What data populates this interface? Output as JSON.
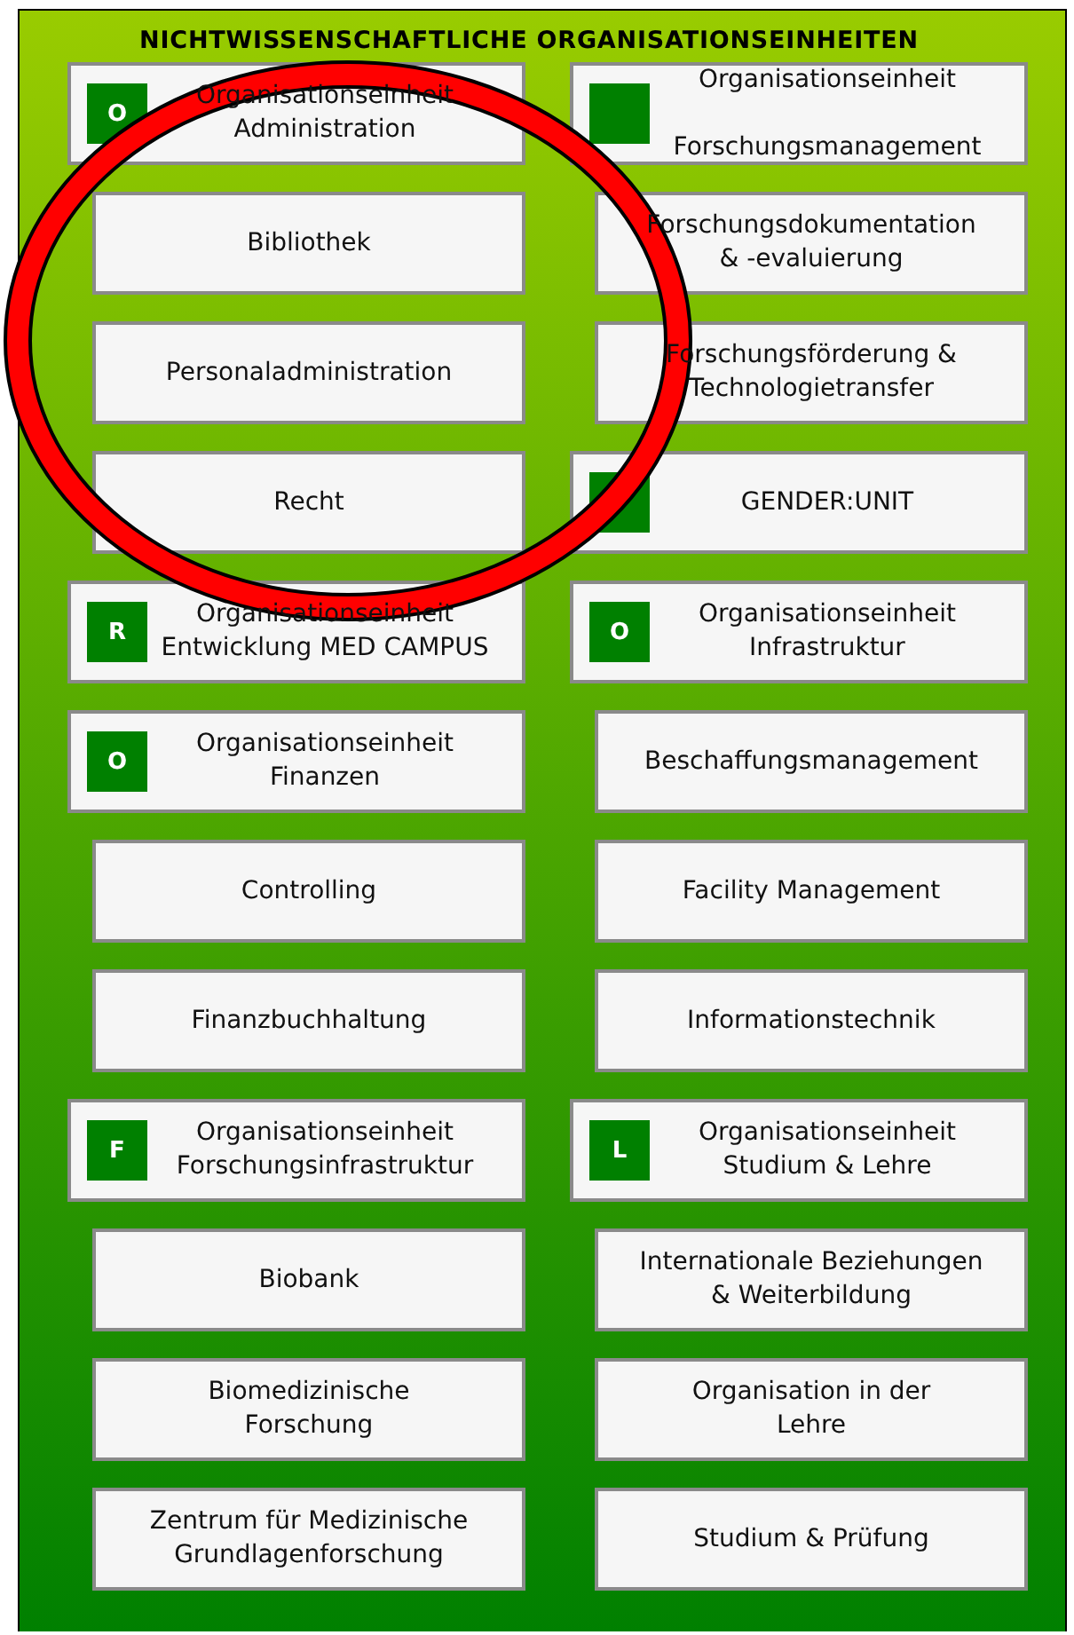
{
  "title": "NICHTWISSENSCHAFTLICHE ORGANISATIONSEINHEITEN",
  "rows": [
    {
      "left": {
        "kind": "unit",
        "badge": "O",
        "text": "Organisationseinheit\nAdministration"
      },
      "right": {
        "kind": "unit",
        "text": "Organisationseinheit\n\nForschungsmanagement"
      }
    },
    {
      "left": {
        "kind": "sub",
        "text": "Bibliothek"
      },
      "right": {
        "kind": "sub",
        "text": "Forschungsdokumentation\n& -evaluierung"
      }
    },
    {
      "left": {
        "kind": "sub",
        "text": "Personaladministration"
      },
      "right": {
        "kind": "sub",
        "text": "Forschungsförderung &\nTechnologietransfer"
      }
    },
    {
      "left": {
        "kind": "sub",
        "text": "Recht"
      },
      "right": {
        "kind": "unit",
        "text": "GENDER:UNIT"
      }
    },
    {
      "left": {
        "kind": "unit",
        "badge": "R",
        "text": "Organisationseinheit\nEntwicklung MED CAMPUS"
      },
      "right": {
        "kind": "unit",
        "badge": "O",
        "text": "Organisationseinheit\nInfrastruktur"
      }
    },
    {
      "left": {
        "kind": "unit",
        "badge": "O",
        "text": "Organisationseinheit\nFinanzen"
      },
      "right": {
        "kind": "sub",
        "text": "Beschaffungsmanagement"
      }
    },
    {
      "left": {
        "kind": "sub",
        "text": "Controlling"
      },
      "right": {
        "kind": "sub",
        "text": "Facility Management"
      }
    },
    {
      "left": {
        "kind": "sub",
        "text": "Finanzbuchhaltung"
      },
      "right": {
        "kind": "sub",
        "text": "Informationstechnik"
      }
    },
    {
      "left": {
        "kind": "unit",
        "badge": "F",
        "text": "Organisationseinheit\nForschungsinfrastruktur"
      },
      "right": {
        "kind": "unit",
        "badge": "L",
        "text": "Organisationseinheit\nStudium & Lehre"
      }
    },
    {
      "left": {
        "kind": "sub",
        "text": "Biobank"
      },
      "right": {
        "kind": "sub",
        "text": "Internationale Beziehungen\n& Weiterbildung"
      }
    },
    {
      "left": {
        "kind": "sub",
        "text": "Biomedizinische\nForschung"
      },
      "right": {
        "kind": "sub",
        "text": "Organisation in der\nLehre"
      }
    },
    {
      "left": {
        "kind": "sub",
        "text": "Zentrum für Medizinische\nGrundlagenforschung"
      },
      "right": {
        "kind": "sub",
        "text": "Studium & Prüfung"
      }
    }
  ]
}
